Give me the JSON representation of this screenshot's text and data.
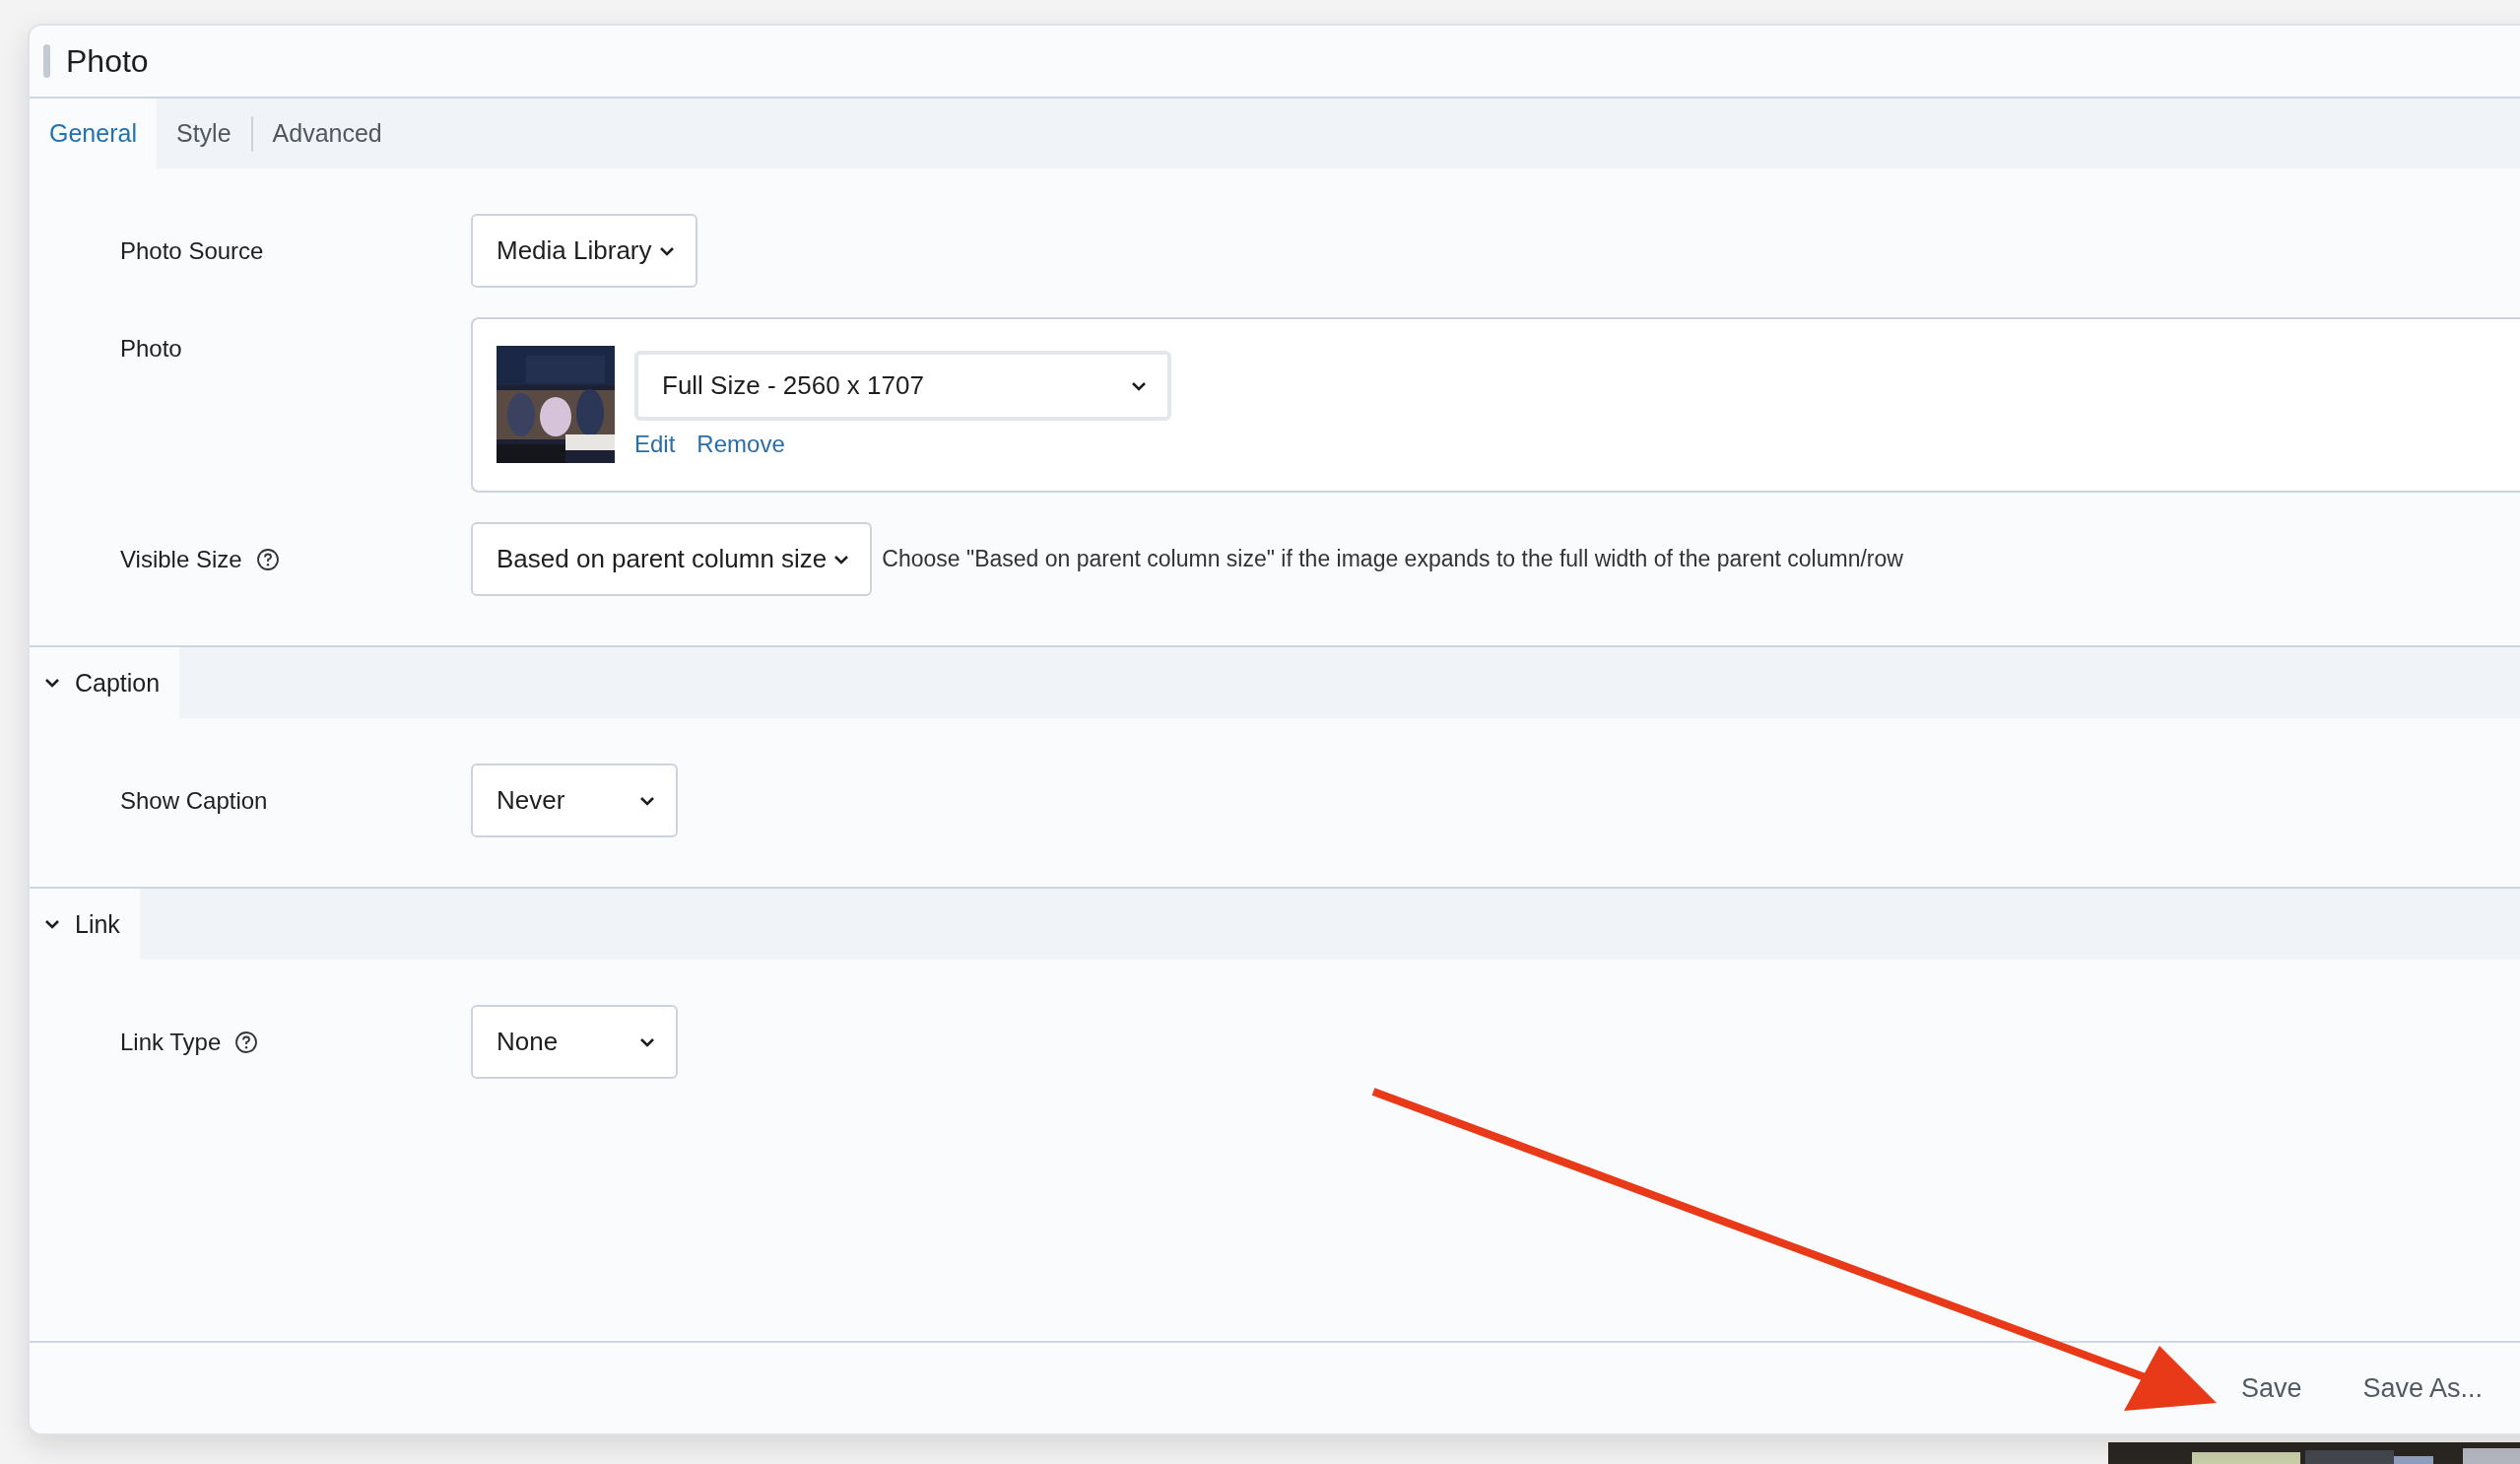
{
  "window": {
    "title": "Photo"
  },
  "tabs": [
    {
      "label": "General",
      "selected": true
    },
    {
      "label": "Style",
      "selected": false
    },
    {
      "label": "Advanced",
      "selected": false
    }
  ],
  "sections": [
    {
      "fields": [
        {
          "kind": "select",
          "label": "Photo Source",
          "value": "Media Library",
          "help_icon": false
        },
        {
          "label": "Photo",
          "size": "Full Size - 2560 x 1707",
          "links": [
            "Edit",
            "Remove"
          ]
        },
        {
          "kind": "select",
          "label": "Visible Size",
          "value": "Based on parent column size",
          "help_icon": true,
          "description": "Choose \"Based on parent column size\" if the image expands to the full width of the parent column/row"
        }
      ]
    },
    {
      "title": "Caption",
      "expanded": true,
      "fields": [
        {
          "kind": "select",
          "label": "Show Caption",
          "value": "Never",
          "help_icon": false
        }
      ]
    },
    {
      "title": "Link",
      "expanded": true,
      "fields": [
        {
          "kind": "select",
          "label": "Link Type",
          "value": "None",
          "help_icon": true
        }
      ]
    }
  ],
  "footer_buttons": [
    "Save",
    "Save As..."
  ]
}
